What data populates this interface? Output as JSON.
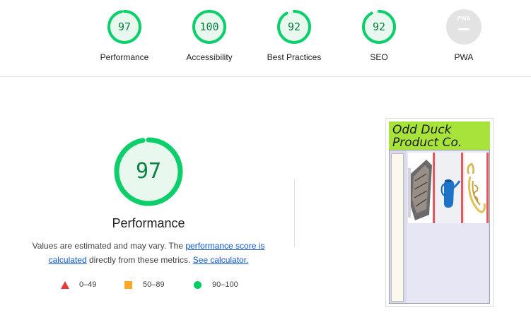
{
  "colors": {
    "pass": "#0cce6b",
    "pass_text": "#0b8043",
    "pass_fill": "#e8f8ef",
    "average": "#ffa400",
    "fail": "#ff3333",
    "neutral": "#e3e3e3"
  },
  "categories": [
    {
      "label": "Performance",
      "score": "97",
      "value": 97
    },
    {
      "label": "Accessibility",
      "score": "100",
      "value": 100
    },
    {
      "label": "Best Practices",
      "score": "92",
      "value": 92
    },
    {
      "label": "SEO",
      "score": "92",
      "value": 92
    },
    {
      "label": "PWA",
      "badge_text": "PWA",
      "icon": "pwa-badge-icon"
    }
  ],
  "main": {
    "score": "97",
    "value": 97,
    "title": "Performance",
    "desc_prefix": "Values are estimated and may vary. The ",
    "desc_link1": "performance score is calculated",
    "desc_middle": " directly from these metrics. ",
    "desc_link2": "See calculator."
  },
  "legend": [
    {
      "shape": "triangle-icon",
      "range": "0–49"
    },
    {
      "shape": "square-icon",
      "range": "50–89"
    },
    {
      "shape": "circle-icon",
      "range": "90–100"
    }
  ],
  "thumbnail": {
    "title_line1": "Odd Duck",
    "title_line2": "Product Co.",
    "products": [
      "product-bag-image",
      "product-watering-can-image",
      "product-corkscrew-image"
    ]
  }
}
